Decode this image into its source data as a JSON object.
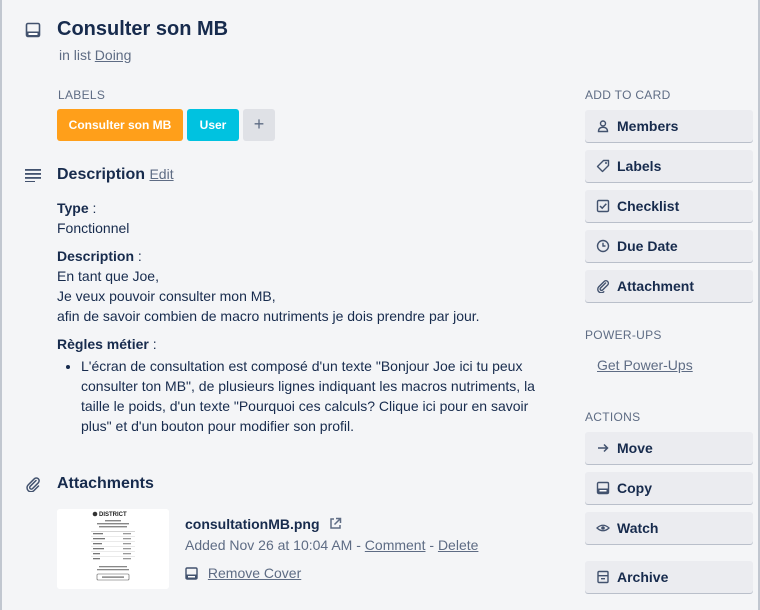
{
  "card": {
    "title": "Consulter son MB",
    "in_list_prefix": "in list",
    "list_name": "Doing"
  },
  "labels": {
    "heading": "LABELS",
    "items": [
      {
        "text": "Consulter son MB",
        "color": "#ff9f1a"
      },
      {
        "text": "User",
        "color": "#00c2e0"
      }
    ],
    "add_symbol": "+"
  },
  "description": {
    "heading": "Description",
    "edit_label": "Edit",
    "type_label": "Type",
    "type_value": "Fonctionnel",
    "desc_label": "Description",
    "desc_lines": [
      "En tant que Joe,",
      "Je veux pouvoir consulter mon MB,",
      "afin de savoir combien de macro nutriments je dois prendre par jour."
    ],
    "rules_label": "Règles métier",
    "rules_items": [
      "L'écran de consultation est composé d'un texte \"Bonjour Joe ici tu peux consulter ton MB\", de plusieurs lignes indiquant les macros nutriments, la taille le poids, d'un texte \"Pourquoi ces calculs? Clique ici pour en savoir plus\" et d'un bouton pour modifier son profil."
    ]
  },
  "attachments": {
    "heading": "Attachments",
    "file_name": "consultationMB.png",
    "added_text": "Added Nov 26 at 10:04 AM",
    "separator": "-",
    "comment_label": "Comment",
    "delete_label": "Delete",
    "remove_cover_label": "Remove Cover",
    "thumbnail_logo": "DISTRICT"
  },
  "sidebar": {
    "add_to_card_heading": "ADD TO CARD",
    "add_to_card": [
      {
        "label": "Members",
        "icon": "person-icon"
      },
      {
        "label": "Labels",
        "icon": "tag-icon"
      },
      {
        "label": "Checklist",
        "icon": "checkbox-icon"
      },
      {
        "label": "Due Date",
        "icon": "clock-icon"
      },
      {
        "label": "Attachment",
        "icon": "paperclip-icon"
      }
    ],
    "powerups_heading": "POWER-UPS",
    "powerups_link": "Get Power-Ups",
    "actions_heading": "ACTIONS",
    "actions": [
      {
        "label": "Move",
        "icon": "arrow-right-icon"
      },
      {
        "label": "Copy",
        "icon": "card-icon"
      },
      {
        "label": "Watch",
        "icon": "eye-icon"
      },
      {
        "label": "Archive",
        "icon": "archive-icon"
      }
    ]
  }
}
